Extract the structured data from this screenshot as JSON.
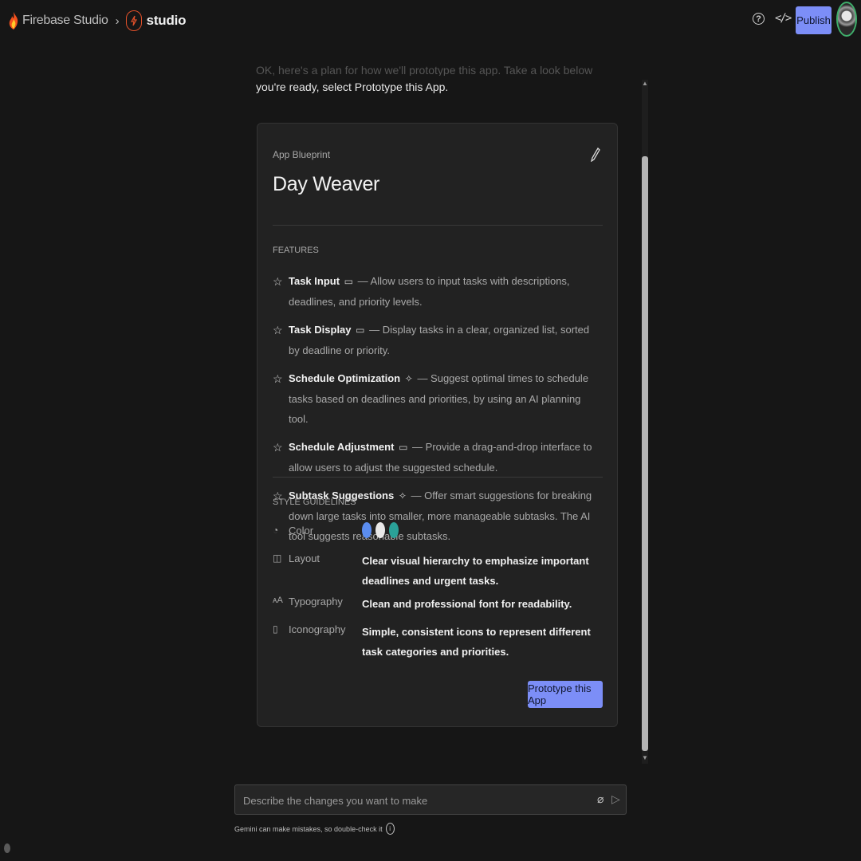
{
  "header": {
    "product": "Firebase Studio",
    "project": "studio",
    "publish_label": "Publish"
  },
  "chat": {
    "partial_message_faded": "OK, here's a plan for how we'll prototype this app. Take a look below and customize as needed, or if",
    "partial_message": "you're ready, select Prototype this App."
  },
  "blueprint": {
    "kicker": "App Blueprint",
    "title": "Day Weaver",
    "features_label": "FEATURES",
    "features": [
      {
        "name": "Task Input",
        "icon": "window-icon",
        "desc": "— Allow users to input tasks with descriptions, deadlines, and priority levels."
      },
      {
        "name": "Task Display",
        "icon": "window-icon",
        "desc": "— Display tasks in a clear, organized list, sorted by deadline or priority."
      },
      {
        "name": "Schedule Optimization",
        "icon": "sparkle-icon",
        "desc": "— Suggest optimal times to schedule tasks based on deadlines and priorities, by using an AI planning tool."
      },
      {
        "name": "Schedule Adjustment",
        "icon": "window-icon",
        "desc": "— Provide a drag-and-drop interface to allow users to adjust the suggested schedule."
      },
      {
        "name": "Subtask Suggestions",
        "icon": "sparkle-icon",
        "desc": "— Offer smart suggestions for breaking down large tasks into smaller, more manageable subtasks. The AI tool suggests reasonable subtasks."
      }
    ],
    "style_label": "STYLE GUIDELINES",
    "style": [
      {
        "label": "Color",
        "icon": "palette-icon",
        "value": "",
        "colors": [
          "#5b8def",
          "#e8e8e8",
          "#2aa198"
        ]
      },
      {
        "label": "Layout",
        "icon": "layout-icon",
        "value": "Clear visual hierarchy to emphasize important deadlines and urgent tasks."
      },
      {
        "label": "Typography",
        "icon": "typography-icon",
        "value": "Clean and professional font for readability."
      },
      {
        "label": "Iconography",
        "icon": "iconography-icon",
        "value": "Simple, consistent icons to represent different task categories and priorities."
      }
    ],
    "prototype_button": "Prototype this App"
  },
  "composer": {
    "placeholder": "Describe the changes you want to make",
    "disclaimer": "Gemini can make mistakes, so double-check it"
  },
  "colors": {
    "accent": "#7c8ef7",
    "brand": "#e1502a",
    "background": "#161616",
    "card": "#222222"
  }
}
